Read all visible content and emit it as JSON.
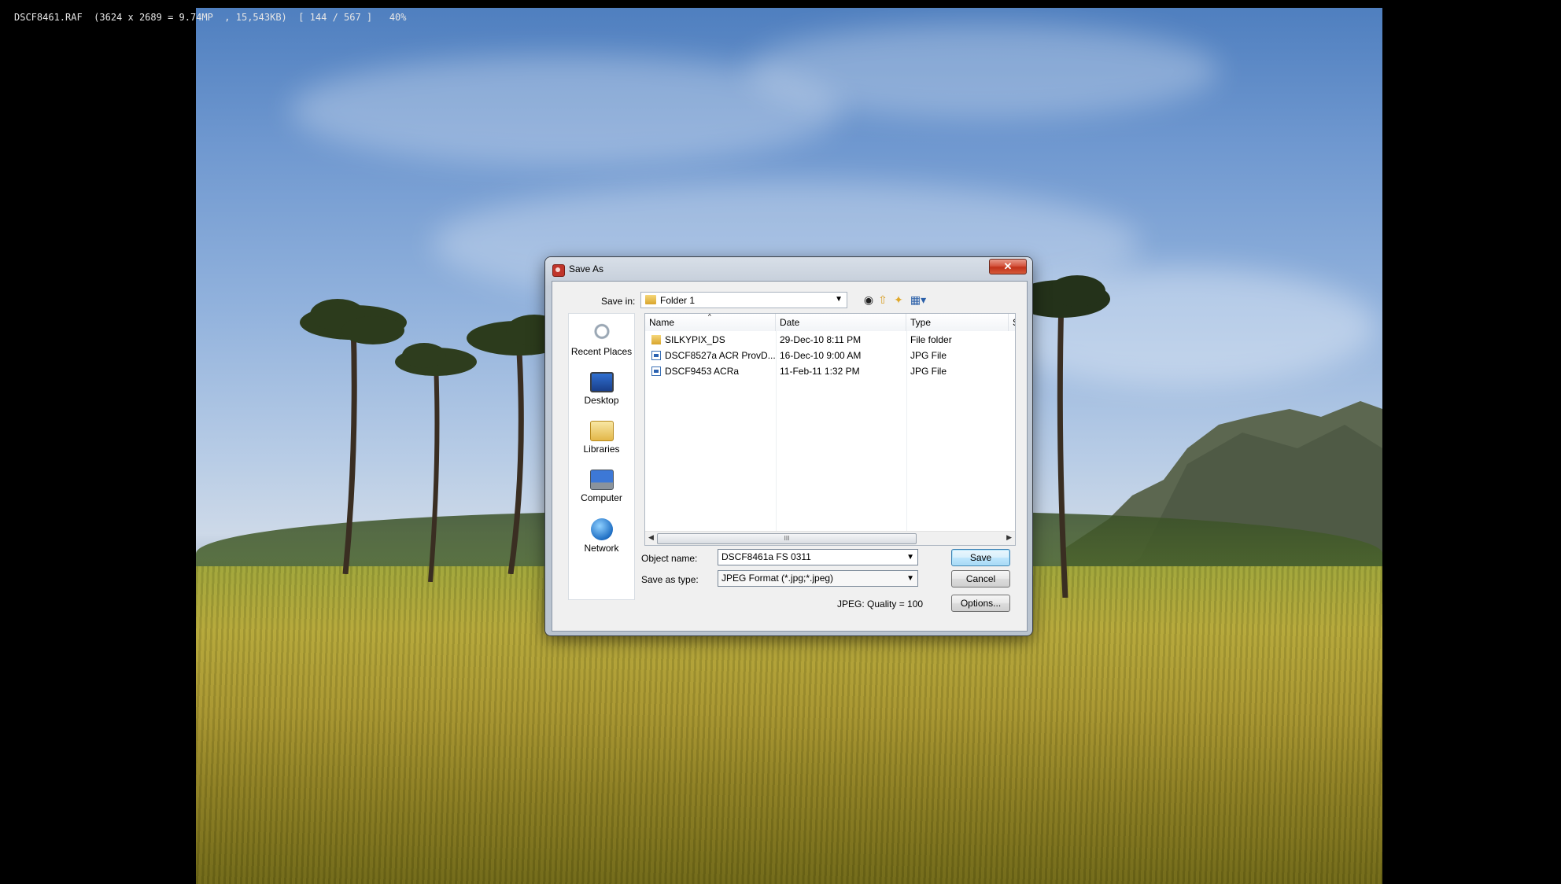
{
  "viewer": {
    "info_line": "DSCF8461.RAF  (3624 x 2689 = 9.74MP  , 15,543KB)  [ 144 / 567 ]   40%"
  },
  "dialog": {
    "title": "Save As",
    "close_glyph": "✕",
    "save_in_label": "Save in:",
    "save_in_value": "Folder 1",
    "toolbar_icons": [
      "back-icon",
      "up-folder-icon",
      "new-folder-icon",
      "view-menu-icon"
    ],
    "places": [
      {
        "label": "Recent Places",
        "icon": "recent-places-icon"
      },
      {
        "label": "Desktop",
        "icon": "desktop-icon"
      },
      {
        "label": "Libraries",
        "icon": "libraries-icon"
      },
      {
        "label": "Computer",
        "icon": "computer-icon"
      },
      {
        "label": "Network",
        "icon": "network-icon"
      }
    ],
    "columns": [
      "Name",
      "Date",
      "Type",
      "S"
    ],
    "files": [
      {
        "name": "SILKYPIX_DS",
        "date": "29-Dec-10 8:11 PM",
        "type": "File folder",
        "icon": "folder"
      },
      {
        "name": "DSCF8527a ACR ProvD...",
        "date": "16-Dec-10 9:00 AM",
        "type": "JPG File",
        "icon": "jpg"
      },
      {
        "name": "DSCF9453 ACRa",
        "date": "11-Feb-11 1:32 PM",
        "type": "JPG File",
        "icon": "jpg"
      }
    ],
    "scroll_grip": "III",
    "object_name_label": "Object name:",
    "object_name_value": "DSCF8461a FS 0311",
    "save_type_label": "Save as type:",
    "save_type_value": "JPEG Format (*.jpg;*.jpeg)",
    "quality_text": "JPEG: Quality = 100",
    "save_button": "Save",
    "cancel_button": "Cancel",
    "options_button": "Options..."
  }
}
